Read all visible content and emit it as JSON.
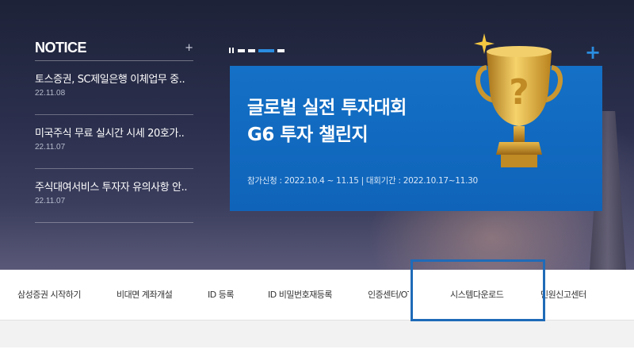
{
  "notice": {
    "title": "NOTICE",
    "more": "+",
    "items": [
      {
        "text": "토스증권, SC제일은행 이체업무 중..",
        "date": "22.11.08"
      },
      {
        "text": "미국주식 무료 실시간 시세 20호가..",
        "date": "22.11.07"
      },
      {
        "text": "주식대여서비스 투자자 유의사항 안..",
        "date": "22.11.07"
      }
    ]
  },
  "banner": {
    "title_line1": "글로벌 실전 투자대회",
    "title_line2": "G6 투자 챌린지",
    "subtitle": "참가신청 : 2022.10.4 ~ 11.15  |  대회기간 : 2022.10.17~11.30",
    "more": "+",
    "icons": {
      "trophy": "trophy-icon",
      "pause": "pause-icon"
    }
  },
  "nav": {
    "items": [
      "삼성증권 시작하기",
      "비대면 계좌개설",
      "ID 등록",
      "ID 비밀번호재등록",
      "인증센터/OTP",
      "시스템다운로드",
      "민원신고센터"
    ]
  },
  "colors": {
    "banner_blue": "#1470c6",
    "highlight": "#1f6bb8",
    "hero_bg": "#2b2f4d"
  }
}
